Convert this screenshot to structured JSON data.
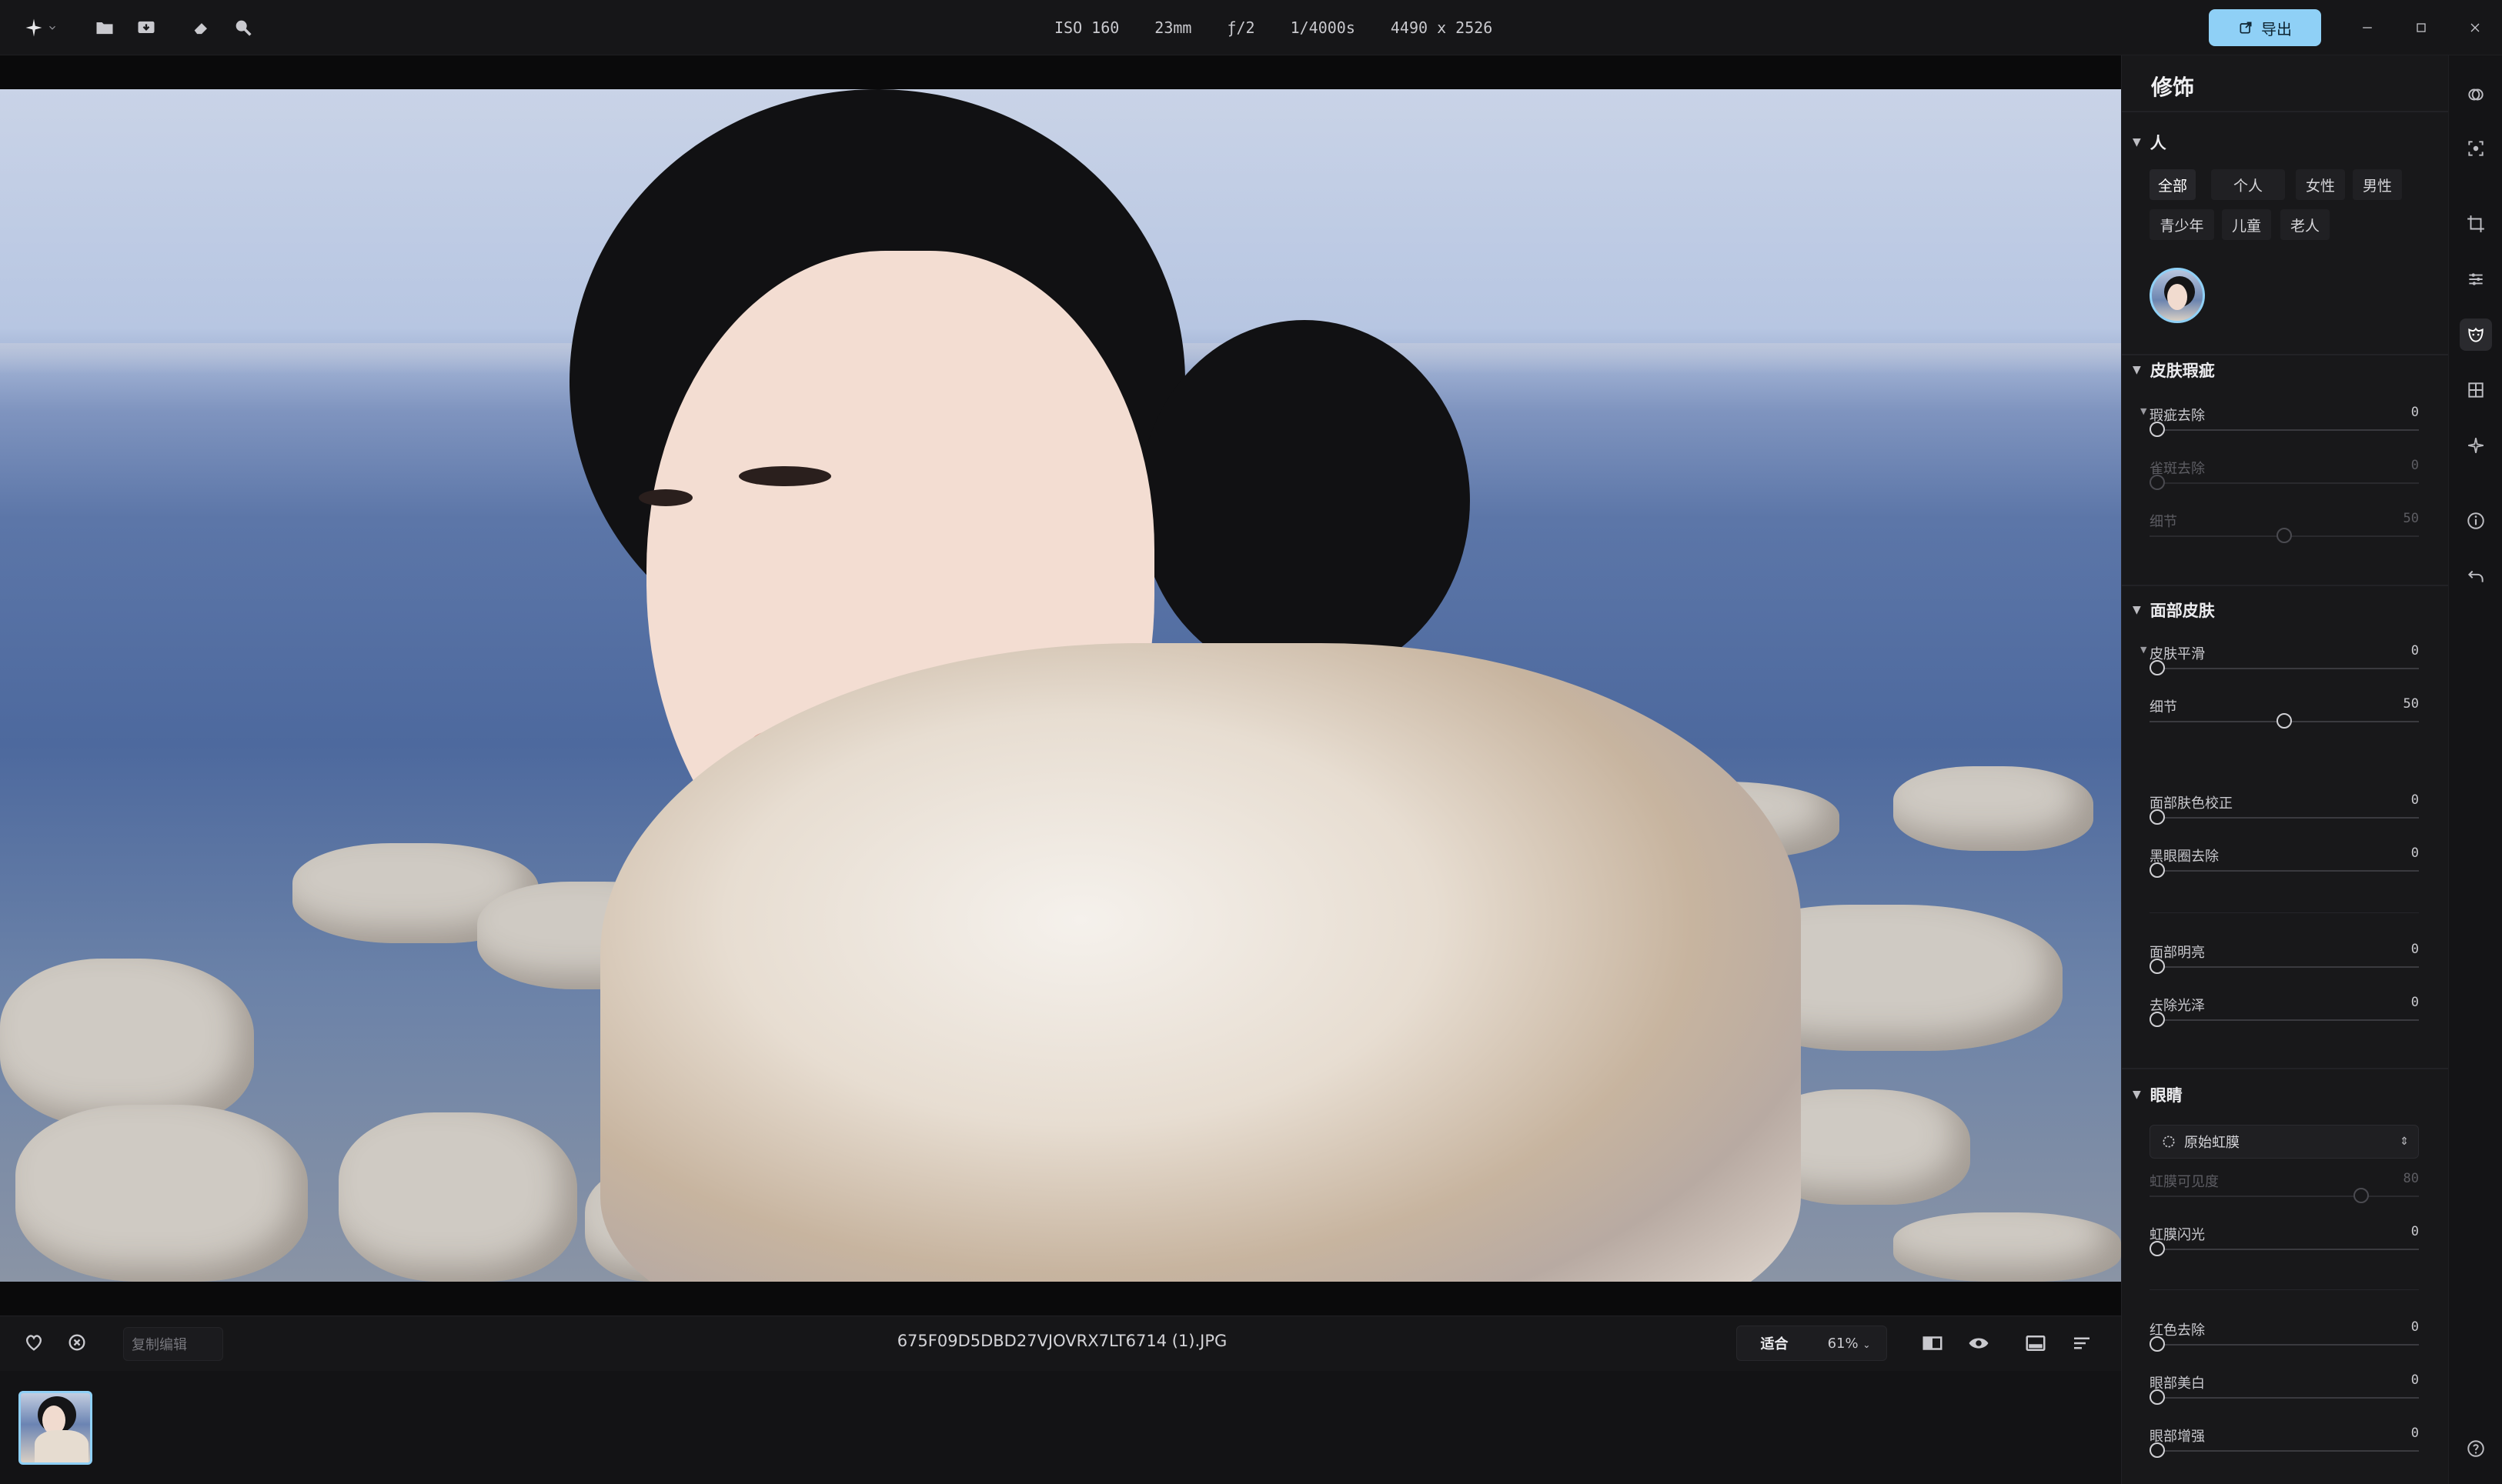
{
  "topbar": {
    "meta": {
      "iso": "ISO 160",
      "focal": "23mm",
      "aperture": "ƒ/2",
      "shutter": "1/4000s",
      "resolution": "4490 x 2526"
    },
    "export_label": "导出",
    "accent": "#8fd0f6"
  },
  "bottombar": {
    "copy_edit_placeholder": "复制编辑",
    "filename": "675F09D5DBD27VJOVRX7LT6714 (1).JPG",
    "fit_label": "适合",
    "zoom_label": "61%"
  },
  "panel": {
    "title": "修饰",
    "people": {
      "heading": "人",
      "chips": [
        "全部",
        "个人",
        "女性",
        "男性",
        "青少年",
        "儿童",
        "老人"
      ],
      "active_chip": "全部"
    },
    "blemish": {
      "heading": "皮肤瑕疵",
      "sliders": [
        {
          "label": "瑕疵去除",
          "value": "0"
        },
        {
          "label": "雀斑去除",
          "value": "0"
        },
        {
          "label": "细节",
          "value": "50"
        }
      ]
    },
    "face_skin": {
      "heading": "面部皮肤",
      "sliders": [
        {
          "label": "皮肤平滑",
          "value": "0"
        },
        {
          "label": "细节",
          "value": "50"
        },
        {
          "label": "面部肤色校正",
          "value": "0"
        },
        {
          "label": "黑眼圈去除",
          "value": "0"
        },
        {
          "label": "面部明亮",
          "value": "0"
        },
        {
          "label": "去除光泽",
          "value": "0"
        }
      ]
    },
    "eyes": {
      "heading": "眼睛",
      "iris_select": "原始虹膜",
      "sliders": [
        {
          "label": "虹膜可见度",
          "value": "80"
        },
        {
          "label": "虹膜闪光",
          "value": "0"
        },
        {
          "label": "红色去除",
          "value": "0"
        },
        {
          "label": "眼部美白",
          "value": "0"
        },
        {
          "label": "眼部增强",
          "value": "0"
        }
      ]
    }
  },
  "rail": {
    "icons": [
      "mask-icon",
      "select-subject-icon",
      "crop-icon",
      "adjust-icon",
      "retouch-icon",
      "grid-icon",
      "ai-spark-icon",
      "info-icon",
      "undo-icon",
      "help-icon"
    ],
    "active": "retouch-icon"
  }
}
